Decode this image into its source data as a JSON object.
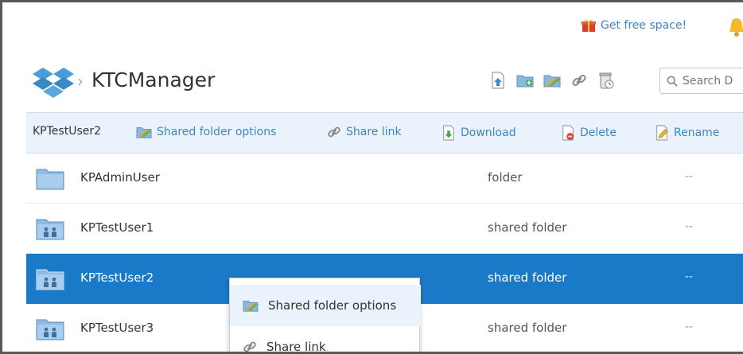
{
  "topbar": {
    "free_space_label": "Get free space!"
  },
  "breadcrumb": {
    "title": "KTCManager"
  },
  "toolbar": {
    "icons": [
      "upload-icon",
      "new-folder-icon",
      "shared-folder-icon",
      "link-icon",
      "recycle-icon"
    ],
    "search_placeholder": "Search D"
  },
  "actions": {
    "selected_name": "KPTestUser2",
    "shared_folder_options": "Shared folder options",
    "share_link": "Share link",
    "download": "Download",
    "delete": "Delete",
    "rename": "Rename"
  },
  "files": [
    {
      "name": "KPAdminUser",
      "type": "folder",
      "modified": "--",
      "icon": "folder-icon"
    },
    {
      "name": "KPTestUser1",
      "type": "shared folder",
      "modified": "--",
      "icon": "shared-folder-icon"
    },
    {
      "name": "KPTestUser2",
      "type": "shared folder",
      "modified": "--",
      "icon": "shared-folder-icon",
      "selected": true
    },
    {
      "name": "KPTestUser3",
      "type": "shared folder",
      "modified": "--",
      "icon": "shared-folder-icon"
    }
  ],
  "context_menu": {
    "items": [
      {
        "label": "Shared folder options",
        "icon": "shared-folder-icon",
        "hovered": true
      },
      {
        "label": "Share link",
        "icon": "link-icon"
      }
    ]
  },
  "colors": {
    "accent": "#3d86c6",
    "selected_row": "#1b7ac7",
    "action_bar": "#eaf3fb"
  }
}
